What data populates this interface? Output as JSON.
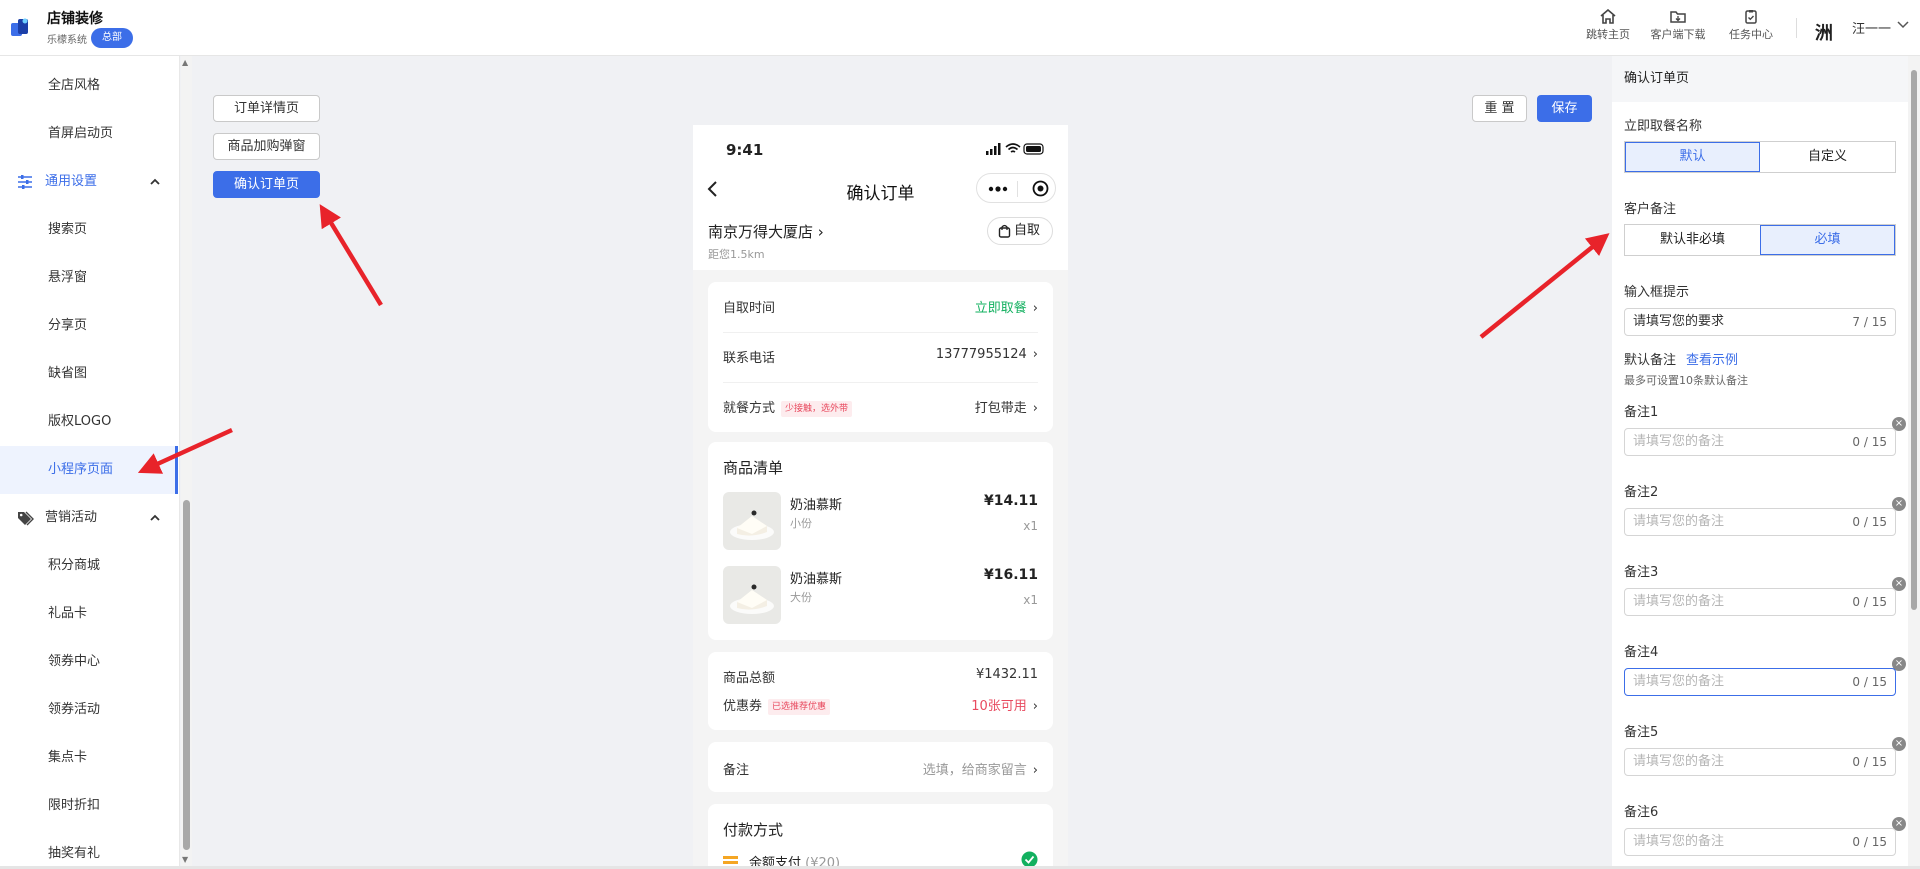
{
  "app": {
    "title": "店铺装修",
    "subtitle": "乐檬系统",
    "badge": "总部"
  },
  "topbar": {
    "actions": [
      {
        "label": "跳转主页",
        "icon": "home-icon"
      },
      {
        "label": "客户端下载",
        "icon": "download-folder-icon"
      },
      {
        "label": "任务中心",
        "icon": "clipboard-icon"
      }
    ],
    "user": {
      "avatar": "洲",
      "name": "汪一一"
    }
  },
  "sidebar": {
    "items_top": [
      "全店风格",
      "首屏启动页"
    ],
    "group_general": "通用设置",
    "items_general": [
      "搜索页",
      "悬浮窗",
      "分享页",
      "缺省图",
      "版权LOGO",
      "小程序页面"
    ],
    "group_marketing": "营销活动",
    "items_marketing": [
      "积分商城",
      "礼品卡",
      "领券中心",
      "领券活动",
      "集点卡",
      "限时折扣",
      "抽奖有礼"
    ]
  },
  "page_buttons": [
    "订单详情页",
    "商品加购弹窗",
    "确认订单页"
  ],
  "toolbar": {
    "reset": "重 置",
    "save": "保存"
  },
  "phone": {
    "time": "9:41",
    "title": "确认订单",
    "store_name": "南京万得大厦店",
    "store_chevron": "›",
    "distance": "距您1.5km",
    "pickup_button": "自取",
    "info_rows": [
      {
        "label": "自取时间",
        "value": "立即取餐"
      },
      {
        "label": "联系电话",
        "value": "13777955124"
      },
      {
        "label": "就餐方式",
        "tag": "少接触，选外带",
        "value": "打包带走"
      }
    ],
    "product_list_title": "商品清单",
    "products": [
      {
        "name": "奶油慕斯",
        "spec": "小份",
        "price": "¥14.11",
        "qty": "x1"
      },
      {
        "name": "奶油慕斯",
        "spec": "大份",
        "price": "¥16.11",
        "qty": "x1"
      }
    ],
    "total_label": "商品总额",
    "total_value": "¥1432.11",
    "coupon_label": "优惠券",
    "coupon_tag": "已选推荐优惠",
    "coupon_value": "10张可用",
    "remark_label": "备注",
    "remark_value": "选填，给商家留言",
    "payment_title": "付款方式",
    "payment_option": "余额支付",
    "payment_amount": "(¥20)",
    "chevron": "›"
  },
  "right_panel": {
    "title": "确认订单页",
    "pickup_name_label": "立即取餐名称",
    "pickup_name_options": [
      "默认",
      "自定义"
    ],
    "remark_label": "客户备注",
    "remark_options": [
      "默认非必填",
      "必填"
    ],
    "input_hint_label": "输入框提示",
    "input_hint_value": "请填写您的要求",
    "input_hint_count": "7 / 15",
    "default_remark_label": "默认备注",
    "view_example": "查看示例",
    "default_remark_hint": "最多可设置10条默认备注",
    "remarks": [
      {
        "label": "备注1",
        "placeholder": "请填写您的备注",
        "count": "0 / 15"
      },
      {
        "label": "备注2",
        "placeholder": "请填写您的备注",
        "count": "0 / 15"
      },
      {
        "label": "备注3",
        "placeholder": "请填写您的备注",
        "count": "0 / 15"
      },
      {
        "label": "备注4",
        "placeholder": "请填写您的备注",
        "count": "0 / 15"
      },
      {
        "label": "备注5",
        "placeholder": "请填写您的备注",
        "count": "0 / 15"
      },
      {
        "label": "备注6",
        "placeholder": "请填写您的备注",
        "count": "0 / 15"
      }
    ],
    "clear_glyph": "×"
  },
  "colors": {
    "accent": "#3c6ee8",
    "annotation_arrow": "#e8232a",
    "green": "#12b05f",
    "red": "#e84a5f"
  }
}
